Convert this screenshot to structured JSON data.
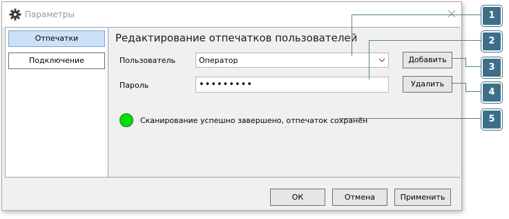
{
  "window": {
    "title": "Параметры",
    "icons": {
      "title": "gear-icon",
      "close": "close-icon"
    }
  },
  "sidebar": {
    "items": [
      {
        "label": "Отпечатки",
        "active": true
      },
      {
        "label": "Подключение",
        "active": false
      }
    ]
  },
  "content": {
    "heading": "Редактирование отпечатков пользователей",
    "user_label": "Пользователь",
    "user_value": "Оператор",
    "password_label": "Пароль",
    "password_value": "•••••••••",
    "add_button": "Добавить",
    "delete_button": "Удалить",
    "status_text": "Сканирование успешно завершено, отпечаток сохранён",
    "status_color": "#00e000"
  },
  "footer": {
    "ok": "ОК",
    "cancel": "Отмена",
    "apply": "Применить"
  },
  "callouts": [
    "1",
    "2",
    "3",
    "4",
    "5"
  ],
  "colors": {
    "callout": "#3d7088",
    "active_tab": "#cce0f7"
  }
}
